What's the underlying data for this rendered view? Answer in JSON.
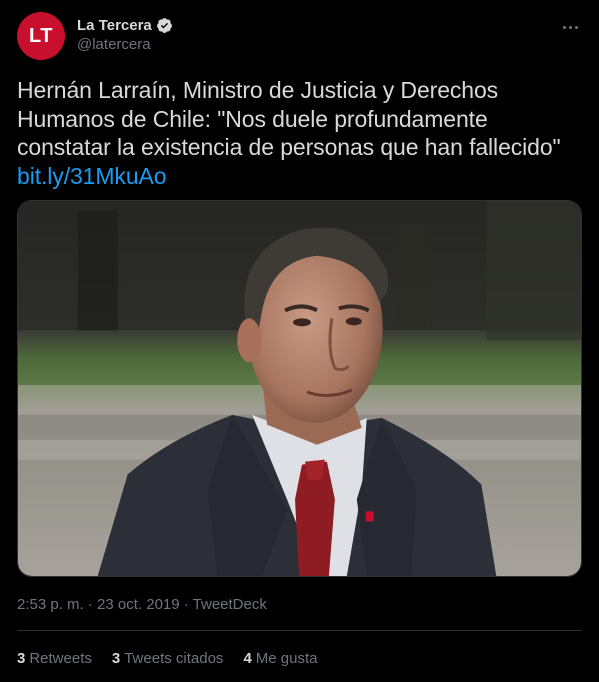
{
  "tweet": {
    "avatar_initials": "LT",
    "display_name": "La Tercera",
    "handle": "@latercera",
    "text": "Hernán Larraín, Ministro de Justicia y Derechos Humanos de Chile: \"Nos duele profundamente constatar la existencia de personas que han fallecido\"",
    "link": "bit.ly/31MkuAo",
    "timestamp": "2:53 p. m. · 23 oct. 2019 · TweetDeck",
    "stats": {
      "retweets_count": "3",
      "retweets_label": "Retweets",
      "quotes_count": "3",
      "quotes_label": "Tweets citados",
      "likes_count": "4",
      "likes_label": "Me gusta"
    }
  },
  "icons": {
    "verified": "verified-badge-icon",
    "more": "more-options-icon"
  },
  "colors": {
    "background": "#000000",
    "text": "#d9d9d9",
    "muted": "#6e767d",
    "link": "#1d9bf0",
    "avatar_brand": "#c8102e",
    "divider": "#2f3336"
  }
}
